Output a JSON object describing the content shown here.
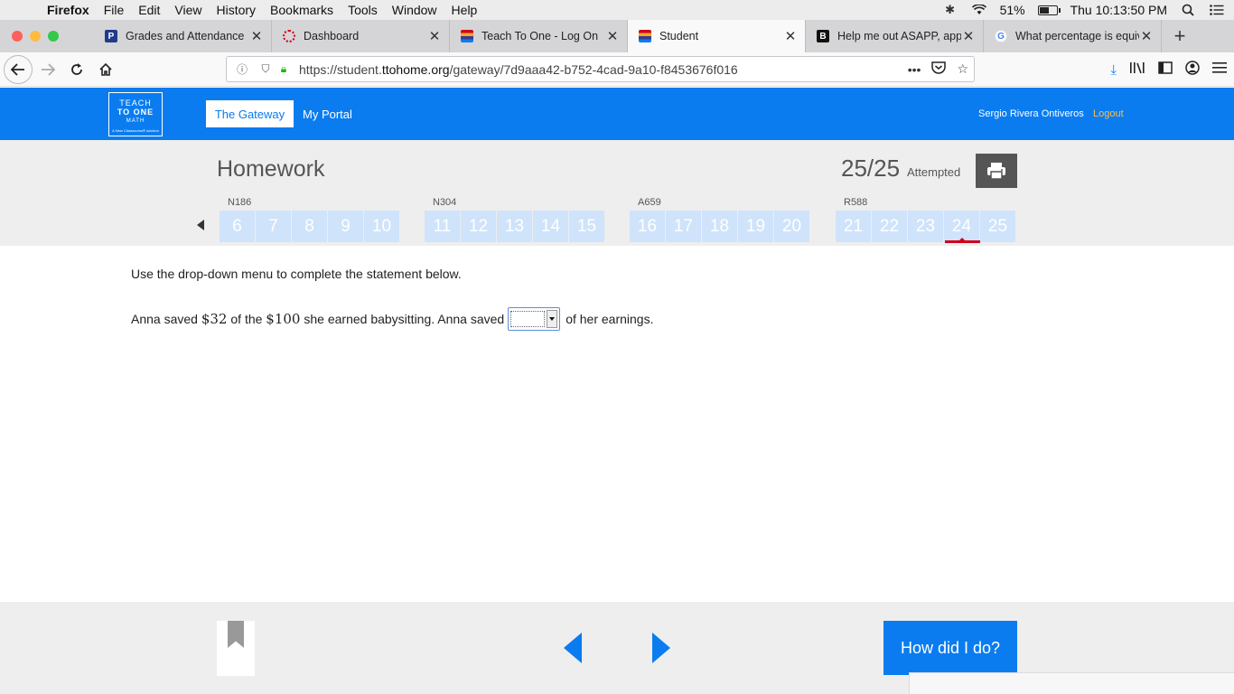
{
  "menubar": {
    "app": "Firefox",
    "items": [
      "File",
      "Edit",
      "View",
      "History",
      "Bookmarks",
      "Tools",
      "Window",
      "Help"
    ],
    "battery": "51%",
    "clock": "Thu 10:13:50 PM"
  },
  "tabs": [
    {
      "title": "Grades and Attendance",
      "favicon": "P",
      "color": "#1f3b8c"
    },
    {
      "title": "Dashboard",
      "favicon": "",
      "color": "#d0021b"
    },
    {
      "title": "Teach To One - Log On",
      "favicon": "",
      "color": "#3b3b8c"
    },
    {
      "title": "Student",
      "favicon": "",
      "color": "#d0021b"
    },
    {
      "title": "Help me out ASAPP, appre",
      "favicon": "B",
      "color": "#111111"
    },
    {
      "title": "What percentage is equiva",
      "favicon": "G",
      "color": "#4285f4"
    }
  ],
  "navbar": {
    "url_prefix": "https://student.",
    "url_host": "ttohome.org",
    "url_path": "/gateway/7d9aaa42-b752-4cad-9a10-f8453676f016"
  },
  "site": {
    "logo_line1": "TEACH",
    "logo_line2": "TO ONE",
    "logo_line3": "MATH",
    "logo_sub": "A New Classrooms® solution",
    "gateway_label": "The Gateway",
    "portal_label": "My Portal",
    "user_name": "Sergio Rivera Ontiveros",
    "logout_label": "Logout"
  },
  "homework": {
    "title": "Homework",
    "score": "25/25",
    "attempted_label": "Attempted",
    "groups": [
      {
        "label": "N186",
        "questions": [
          "6",
          "7",
          "8",
          "9",
          "10"
        ]
      },
      {
        "label": "N304",
        "questions": [
          "11",
          "12",
          "13",
          "14",
          "15"
        ]
      },
      {
        "label": "A659",
        "questions": [
          "16",
          "17",
          "18",
          "19",
          "20"
        ]
      },
      {
        "label": "R588",
        "questions": [
          "21",
          "22",
          "23",
          "24",
          "25"
        ]
      }
    ],
    "current_question": "24"
  },
  "question": {
    "instruction": "Use the drop-down menu to complete the statement below.",
    "part1": "Anna saved ",
    "amount1": "$32",
    "part2": " of the ",
    "amount2": "$100",
    "part3": " she earned babysitting. Anna saved",
    "dropdown_value": "",
    "part4": "of her earnings."
  },
  "footer": {
    "how_label": "How did I do?"
  },
  "colors": {
    "brand_blue": "#0a7cf0",
    "question_tile": "#cfe3fb",
    "current_marker": "#d0021b",
    "logout": "#ffc04a"
  }
}
